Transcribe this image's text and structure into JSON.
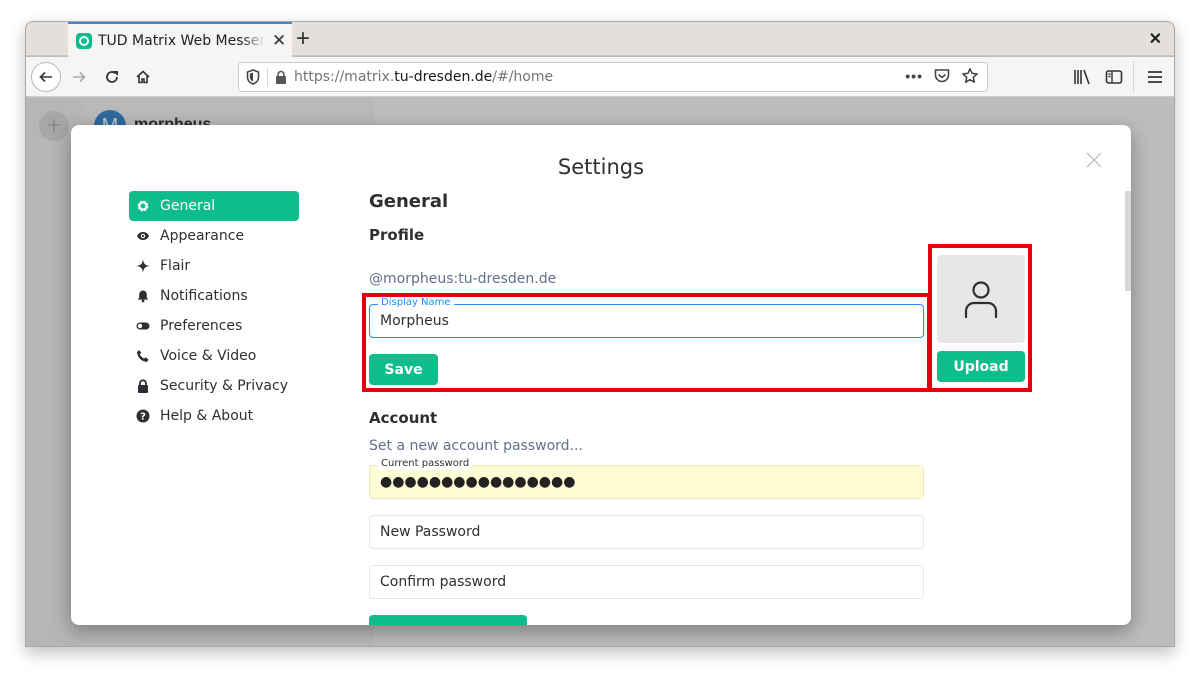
{
  "browser": {
    "tab_title": "TUD Matrix Web Messenger",
    "new_tab_label": "+",
    "url": {
      "prefix": "https://matrix.",
      "domain": "tu-dresden.de",
      "suffix": "/#/home"
    },
    "icons": {
      "back": "back-arrow-icon",
      "forward": "forward-arrow-icon",
      "reload": "reload-icon",
      "home": "home-icon",
      "shield": "tracking-protection-shield-icon",
      "lock": "lock-icon",
      "more": "more-actions-icon",
      "pocket": "pocket-icon",
      "bookmark": "bookmark-star-icon",
      "library": "library-icon",
      "sidebar": "sidebar-icon",
      "menu": "hamburger-menu-icon"
    }
  },
  "app_background": {
    "avatar_letter": "M",
    "username": "morpheus"
  },
  "settings": {
    "title": "Settings",
    "nav": [
      {
        "label": "General",
        "icon": "gear-icon",
        "active": true
      },
      {
        "label": "Appearance",
        "icon": "eye-icon",
        "active": false
      },
      {
        "label": "Flair",
        "icon": "sparkle-icon",
        "active": false
      },
      {
        "label": "Notifications",
        "icon": "bell-icon",
        "active": false
      },
      {
        "label": "Preferences",
        "icon": "toggle-icon",
        "active": false
      },
      {
        "label": "Voice & Video",
        "icon": "phone-icon",
        "active": false
      },
      {
        "label": "Security & Privacy",
        "icon": "lock-icon",
        "active": false
      },
      {
        "label": "Help & About",
        "icon": "help-icon",
        "active": false
      }
    ],
    "general": {
      "heading": "General",
      "profile": {
        "heading": "Profile",
        "user_id": "@morpheus:tu-dresden.de",
        "display_name_label": "Display Name",
        "display_name_value": "Morpheus",
        "save_label": "Save",
        "upload_label": "Upload"
      },
      "account": {
        "heading": "Account",
        "set_password_link": "Set a new account password...",
        "current_password_label": "Current password",
        "current_password_value": "●●●●●●●●●●●●●●●●",
        "new_password_placeholder": "New Password",
        "confirm_password_placeholder": "Confirm password"
      }
    }
  },
  "colors": {
    "accent": "#0dbd8b",
    "highlight": "#e5000d",
    "focus": "#238cf5",
    "autofill": "#fefcd4",
    "secondary_text": "#61708b"
  }
}
